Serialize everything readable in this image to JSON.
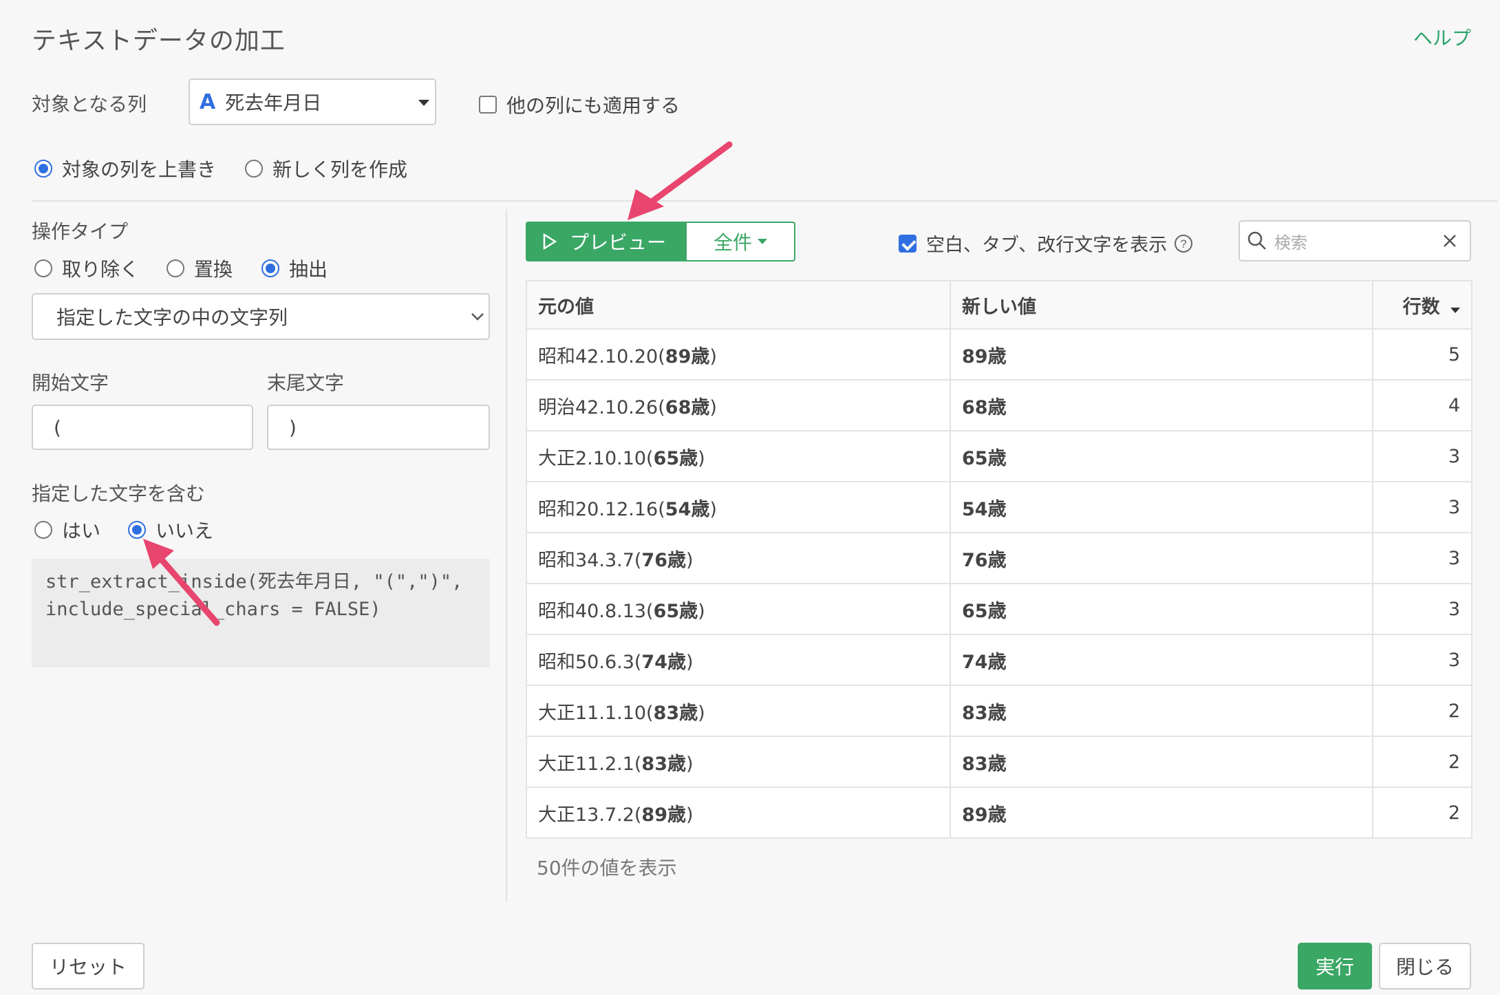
{
  "header": {
    "title": "テキストデータの加工",
    "help": "ヘルプ"
  },
  "target": {
    "label": "対象となる列",
    "type_icon": "A",
    "column": "死去年月日",
    "apply_other": "他の列にも適用する"
  },
  "output_mode": {
    "overwrite": "対象の列を上書き",
    "new_column": "新しく列を作成"
  },
  "operation": {
    "label": "操作タイプ",
    "remove": "取り除く",
    "replace": "置換",
    "extract": "抽出",
    "method": "指定した文字の中の文字列"
  },
  "delimiters": {
    "start_label": "開始文字",
    "end_label": "末尾文字",
    "start_value": "(",
    "end_value": ")"
  },
  "include": {
    "label": "指定した文字を含む",
    "yes": "はい",
    "no": "いいえ"
  },
  "code": "str_extract_inside(死去年月日, \"(\",\")\", include_special_chars = FALSE)",
  "preview": {
    "button": "プレビュー",
    "all": "全件",
    "show_whitespace": "空白、タブ、改行文字を表示",
    "search_placeholder": "検索"
  },
  "table": {
    "headers": {
      "original": "元の値",
      "new": "新しい値",
      "count": "行数"
    },
    "rows": [
      {
        "prefix": "昭和42.10.20(",
        "bold": "89歳",
        "suffix": ")",
        "new": "89歳",
        "count": "5"
      },
      {
        "prefix": "明治42.10.26(",
        "bold": "68歳",
        "suffix": ")",
        "new": "68歳",
        "count": "4"
      },
      {
        "prefix": "大正2.10.10(",
        "bold": "65歳",
        "suffix": ")",
        "new": "65歳",
        "count": "3"
      },
      {
        "prefix": "昭和20.12.16(",
        "bold": "54歳",
        "suffix": ")",
        "new": "54歳",
        "count": "3"
      },
      {
        "prefix": "昭和34.3.7(",
        "bold": "76歳",
        "suffix": ")",
        "new": "76歳",
        "count": "3"
      },
      {
        "prefix": "昭和40.8.13(",
        "bold": "65歳",
        "suffix": ")",
        "new": "65歳",
        "count": "3"
      },
      {
        "prefix": "昭和50.6.3(",
        "bold": "74歳",
        "suffix": ")",
        "new": "74歳",
        "count": "3"
      },
      {
        "prefix": "大正11.1.10(",
        "bold": "83歳",
        "suffix": ")",
        "new": "83歳",
        "count": "2"
      },
      {
        "prefix": "大正11.2.1(",
        "bold": "83歳",
        "suffix": ")",
        "new": "83歳",
        "count": "2"
      },
      {
        "prefix": "大正13.7.2(",
        "bold": "89歳",
        "suffix": ")",
        "new": "89歳",
        "count": "2"
      }
    ],
    "footer": "50件の値を表示"
  },
  "footer": {
    "reset": "リセット",
    "run": "実行",
    "close": "閉じる"
  },
  "colors": {
    "accent_green": "#3aa765",
    "radio_blue": "#2f6fe0",
    "annotation_arrow": "#e8456f"
  },
  "icons": [
    "chevron-down-icon",
    "play-icon",
    "search-icon",
    "close-icon",
    "help-circle-icon",
    "arrow-annotation"
  ]
}
